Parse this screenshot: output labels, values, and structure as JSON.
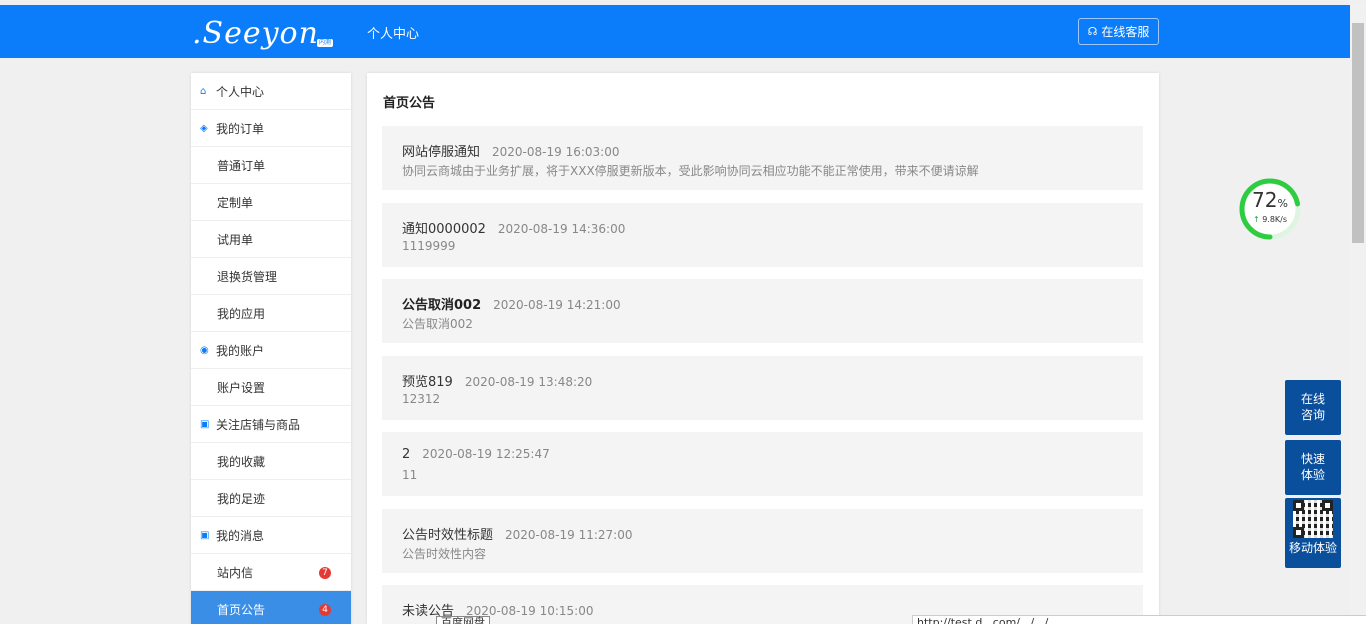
{
  "header": {
    "logo_text": ".Seeyon",
    "logo_sub": "内测",
    "title": "个人中心",
    "service_label": "在线客服",
    "service_icon": "headset-icon"
  },
  "sidebar": {
    "items": [
      {
        "type": "group",
        "icon": "home-icon",
        "label": "个人中心"
      },
      {
        "type": "group",
        "icon": "layers-icon",
        "label": "我的订单"
      },
      {
        "type": "sub",
        "label": "普通订单"
      },
      {
        "type": "sub",
        "label": "定制单"
      },
      {
        "type": "sub",
        "label": "试用单"
      },
      {
        "type": "sub",
        "label": "退换货管理"
      },
      {
        "type": "sub",
        "label": "我的应用"
      },
      {
        "type": "group",
        "icon": "account-icon",
        "label": "我的账户"
      },
      {
        "type": "sub",
        "label": "账户设置"
      },
      {
        "type": "group",
        "icon": "square-icon",
        "label": "关注店铺与商品"
      },
      {
        "type": "sub",
        "label": "我的收藏"
      },
      {
        "type": "sub",
        "label": "我的足迹"
      },
      {
        "type": "group",
        "icon": "square-icon",
        "label": "我的消息"
      },
      {
        "type": "sub",
        "label": "站内信",
        "badge": "7"
      },
      {
        "type": "sub",
        "label": "首页公告",
        "badge": "4",
        "active": true
      }
    ]
  },
  "main": {
    "title": "首页公告",
    "notices": [
      {
        "title": "网站停服通知",
        "time": "2020-08-19 16:03:00",
        "content": "协同云商城由于业务扩展，将于XXX停服更新版本，受此影响协同云相应功能不能正常使用，带来不便请谅解",
        "bold": false
      },
      {
        "title": "通知0000002",
        "time": "2020-08-19 14:36:00",
        "content": "1119999",
        "bold": false
      },
      {
        "title": "公告取消002",
        "time": "2020-08-19 14:21:00",
        "content": "公告取消002",
        "bold": true
      },
      {
        "title": "预览819",
        "time": "2020-08-19 13:48:20",
        "content": "12312",
        "bold": false
      },
      {
        "title": "2",
        "time": "2020-08-19 12:25:47",
        "content": "11",
        "bold": false
      },
      {
        "title": "公告时效性标题",
        "time": "2020-08-19 11:27:00",
        "content": "公告时效性内容",
        "bold": false
      },
      {
        "title": "未读公告",
        "time": "2020-08-19 10:15:00",
        "content": "",
        "bold": false
      }
    ]
  },
  "gauge": {
    "percent": "72",
    "unit": "%",
    "speed": "9.8K/s",
    "arrow": "↑",
    "level": 0.72,
    "color": "#2ecc40"
  },
  "float_buttons": {
    "consult": "在线咨询",
    "trial": "快速体验",
    "mobile": "移动体验"
  },
  "tooltip": "百度网盘",
  "status_url": "http://test.d...com/.../.../..."
}
